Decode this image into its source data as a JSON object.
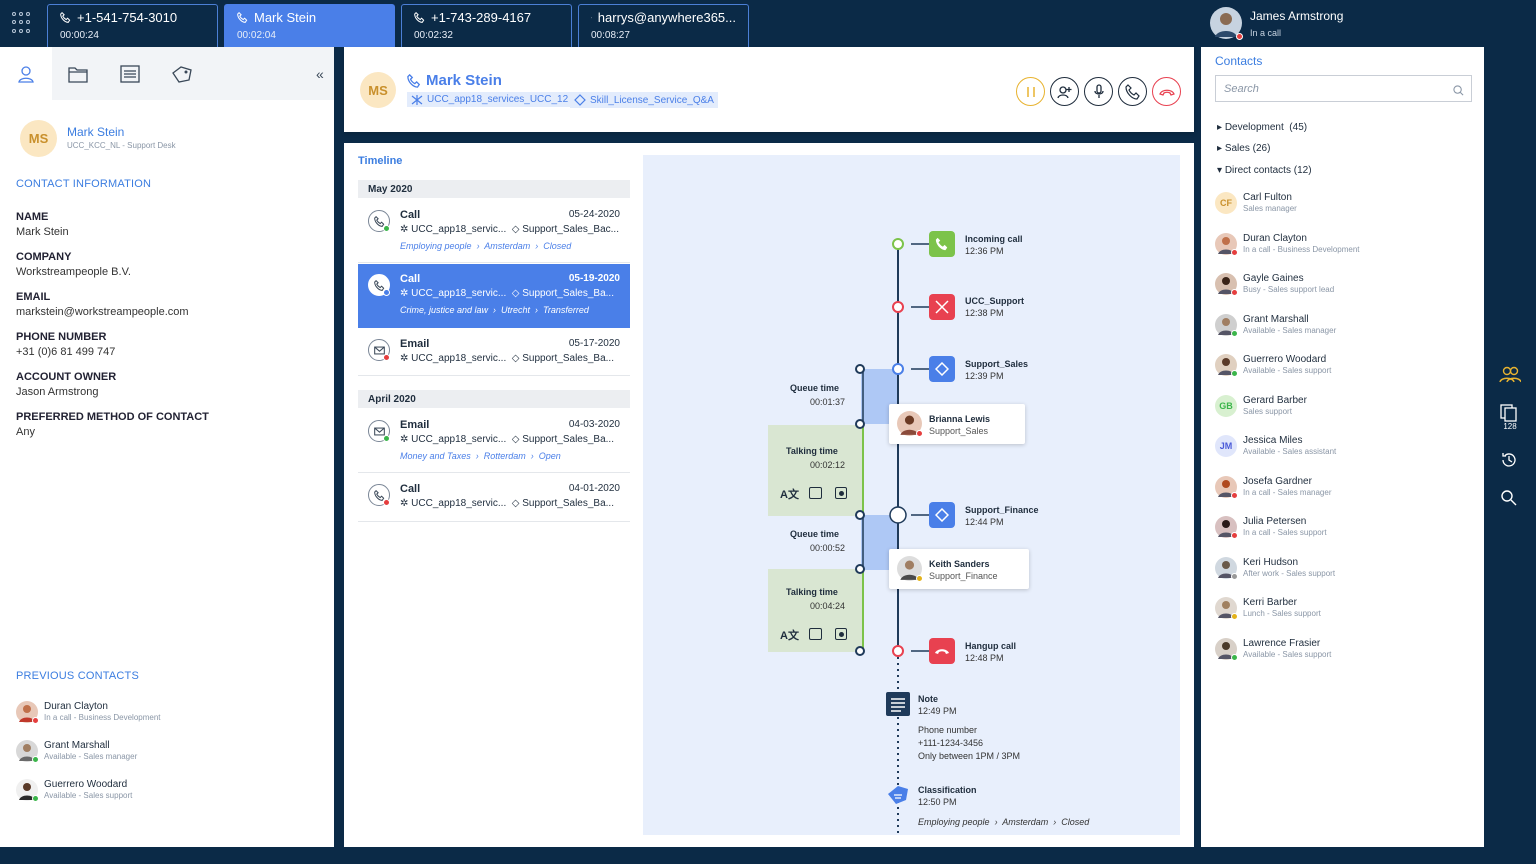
{
  "topbar": {
    "tabs": [
      {
        "title": "+1-541-754-3010",
        "time": "00:00:24",
        "icon": "phone-icon"
      },
      {
        "title": "Mark Stein",
        "time": "00:02:04",
        "icon": "phone-icon"
      },
      {
        "title": "+1-743-289-4167",
        "time": "00:02:32",
        "icon": "phone-icon"
      },
      {
        "title": "harrys@anywhere365...",
        "time": "00:08:27",
        "icon": "mail-icon"
      }
    ],
    "user": {
      "name": "James Armstrong",
      "status": "In a call"
    }
  },
  "left": {
    "profile": {
      "initials": "MS",
      "name": "Mark Stein",
      "sub": "UCC_KCC_NL - Support Desk"
    },
    "contact_info_title": "CONTACT INFORMATION",
    "fields": [
      {
        "label": "NAME",
        "value": "Mark Stein"
      },
      {
        "label": "COMPANY",
        "value": "Workstreampeople B.V."
      },
      {
        "label": "EMAIL",
        "value": "markstein@workstreampeople.com"
      },
      {
        "label": "PHONE NUMBER",
        "value": "+31 (0)6 81 499 747"
      },
      {
        "label": "ACCOUNT OWNER",
        "value": "Jason Armstrong"
      },
      {
        "label": "PREFERRED METHOD OF CONTACT",
        "value": "Any"
      }
    ],
    "previous_title": "PREVIOUS CONTACTS",
    "previous": [
      {
        "name": "Duran Clayton",
        "sub": "In a call - Business Development",
        "status": "red"
      },
      {
        "name": "Grant Marshall",
        "sub": "Available - Sales manager",
        "status": "green"
      },
      {
        "name": "Guerrero Woodard",
        "sub": "Available - Sales support",
        "status": "green"
      }
    ]
  },
  "header": {
    "initials": "MS",
    "name": "Mark Stein",
    "tag1": "UCC_app18_services_UCC_12",
    "tag2": "Skill_License_Service_Q&A"
  },
  "timeline": {
    "title": "Timeline",
    "months": [
      "May 2020",
      "April 2020"
    ],
    "items": [
      {
        "type": "Call",
        "date": "05-24-2020",
        "service": "UCC_app18_servic...",
        "skill": "Support_Sales_Bac...",
        "crumbs": [
          "Employing people",
          "Amsterdam",
          "Closed"
        ],
        "status": "green"
      },
      {
        "type": "Call",
        "date": "05-19-2020",
        "service": "UCC_app18_servic...",
        "skill": "Support_Sales_Ba...",
        "crumbs": [
          "Crime, justice and law",
          "Utrecht",
          "Transferred"
        ],
        "status": "blue"
      },
      {
        "type": "Email",
        "date": "05-17-2020",
        "service": "UCC_app18_servic...",
        "skill": "Support_Sales_Ba...",
        "crumbs": [],
        "status": "red"
      },
      {
        "type": "Email",
        "date": "04-03-2020",
        "service": "UCC_app18_servic...",
        "skill": "Support_Sales_Ba...",
        "crumbs": [
          "Money and Taxes",
          "Rotterdam",
          "Open"
        ],
        "status": "green"
      },
      {
        "type": "Call",
        "date": "04-01-2020",
        "service": "UCC_app18_servic...",
        "skill": "Support_Sales_Ba...",
        "crumbs": [],
        "status": "red"
      }
    ]
  },
  "flow": {
    "events": [
      {
        "title": "Incoming call",
        "time": "12:36 PM"
      },
      {
        "title": "UCC_Support",
        "time": "12:38 PM"
      },
      {
        "title": "Support_Sales",
        "time": "12:39 PM"
      },
      {
        "title": "Support_Finance",
        "time": "12:44 PM"
      },
      {
        "title": "Hangup call",
        "time": "12:48 PM"
      }
    ],
    "queue1": {
      "label": "Queue time",
      "value": "00:01:37"
    },
    "talk1": {
      "label": "Talking time",
      "value": "00:02:12"
    },
    "queue2": {
      "label": "Queue time",
      "value": "00:00:52"
    },
    "talk2": {
      "label": "Talking time",
      "value": "00:04:24"
    },
    "agent1": {
      "name": "Brianna Lewis",
      "skill": "Support_Sales"
    },
    "agent2": {
      "name": "Keith Sanders",
      "skill": "Support_Finance"
    },
    "note": {
      "title": "Note",
      "time": "12:49 PM",
      "line1": "Phone number",
      "line2": "+111-1234-3456",
      "line3": "Only between 1PM / 3PM"
    },
    "classification": {
      "title": "Classification",
      "time": "12:50 PM",
      "crumbs": [
        "Employing people",
        "Amsterdam",
        "Closed"
      ]
    }
  },
  "contacts": {
    "title": "Contacts",
    "search_placeholder": "Search",
    "groups": [
      {
        "label": "Development",
        "count": "(45)"
      },
      {
        "label": "Sales",
        "count": "(26)"
      },
      {
        "label": "Direct contacts",
        "count": "(12)"
      }
    ],
    "list": [
      {
        "name": "Carl Fulton",
        "sub": "Sales manager",
        "initials": "CF",
        "status": ""
      },
      {
        "name": "Duran Clayton",
        "sub": "In a call - Business Development",
        "initials": "",
        "status": "red"
      },
      {
        "name": "Gayle Gaines",
        "sub": "Busy - Sales support lead",
        "initials": "",
        "status": "red"
      },
      {
        "name": "Grant Marshall",
        "sub": "Available - Sales manager",
        "initials": "",
        "status": "green"
      },
      {
        "name": "Guerrero Woodard",
        "sub": "Available - Sales support",
        "initials": "",
        "status": "green"
      },
      {
        "name": "Gerard Barber",
        "sub": "Sales support",
        "initials": "GB",
        "status": ""
      },
      {
        "name": "Jessica Miles",
        "sub": "Available - Sales assistant",
        "initials": "JM",
        "status": ""
      },
      {
        "name": "Josefa Gardner",
        "sub": "In a call - Sales manager",
        "initials": "",
        "status": "red"
      },
      {
        "name": "Julia Petersen",
        "sub": "In a call - Sales support",
        "initials": "",
        "status": "red"
      },
      {
        "name": "Keri Hudson",
        "sub": "After work - Sales support",
        "initials": "",
        "status": "gray"
      },
      {
        "name": "Kerri Barber",
        "sub": "Lunch - Sales support",
        "initials": "",
        "status": "yellow"
      },
      {
        "name": "Lawrence Frasier",
        "sub": "Available - Sales support",
        "initials": "",
        "status": "green"
      }
    ]
  },
  "rail": {
    "count": "128"
  },
  "colors": {
    "accent": "#4a7fe8",
    "navy": "#0b2a47",
    "green": "#7cc34a",
    "red": "#e84150"
  }
}
